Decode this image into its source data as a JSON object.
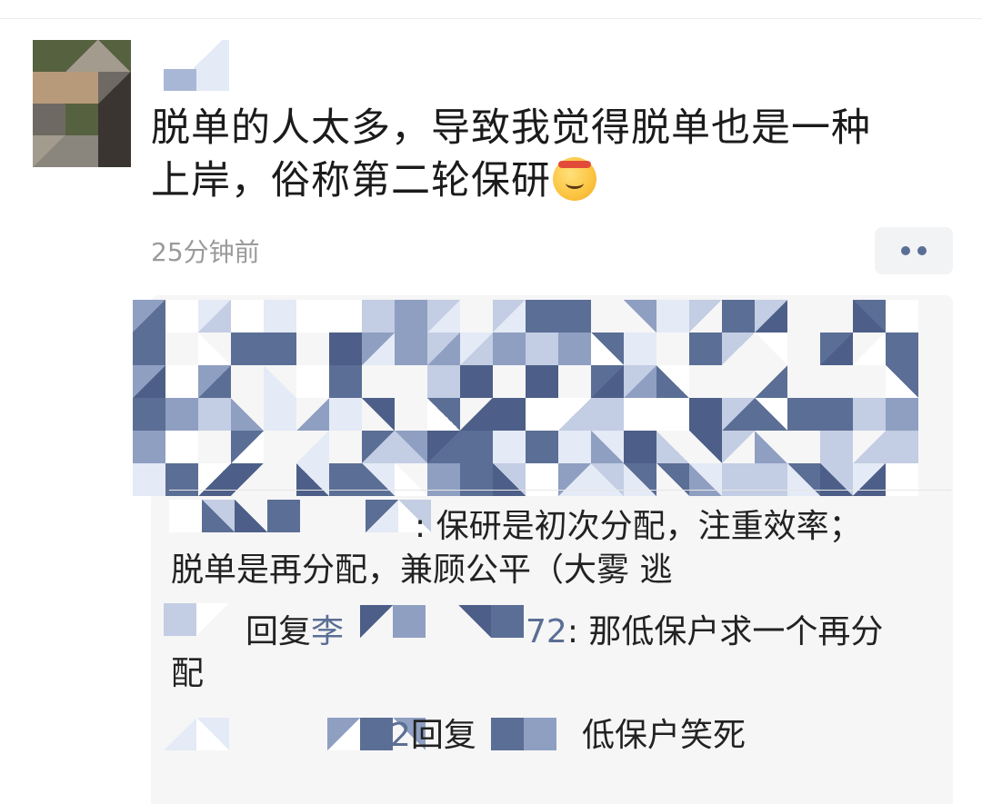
{
  "comment": {
    "text_line1": "脱单的人太多，导致我觉得脱单也是一种",
    "text_line2": "上岸，俗称第二轮保研",
    "emoji": "saluting-face-emoji",
    "timestamp": "25分钟前",
    "more_icon": "more-dots-icon"
  },
  "replies": [
    {
      "prefix": ": ",
      "text_line1": "保研是初次分配，注重效率；",
      "text_line2": "脱单是再分配，兼顾公平（大雾 逃"
    },
    {
      "reply_word": "回复",
      "partial_name_start": "李",
      "partial_name_end": "72",
      "text_line1": ": 那低保户求一个再分",
      "text_line2": "配"
    },
    {
      "partial_name": "72",
      "reply_word": "回复",
      "text": "低保户笑死"
    }
  ],
  "colors": {
    "link": "#5b6e95",
    "text": "#1b1b1b",
    "timestamp": "#9a9a9a",
    "panel": "#f6f6f6"
  }
}
